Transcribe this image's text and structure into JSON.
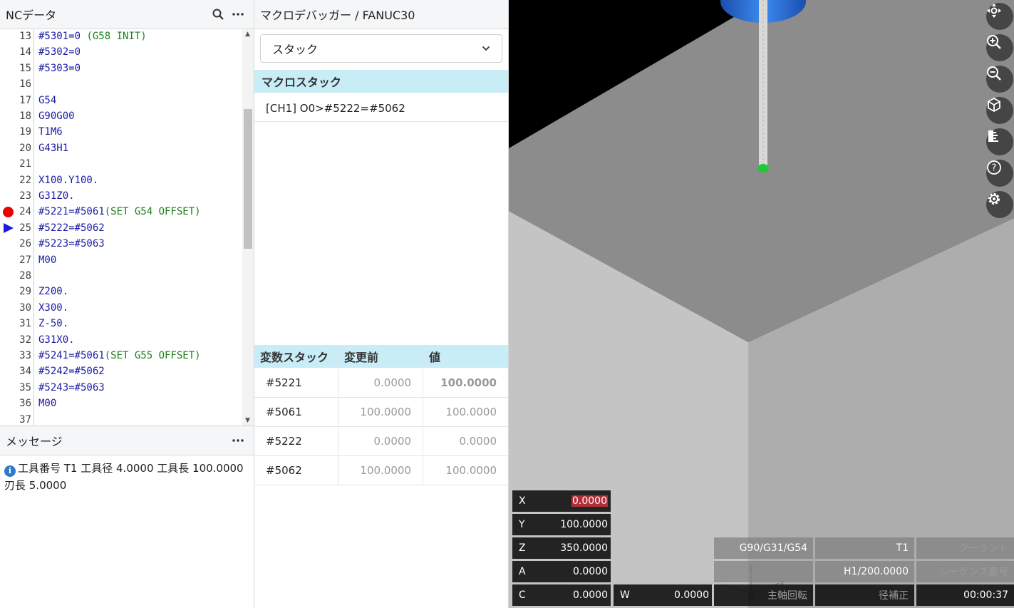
{
  "nc_panel": {
    "title": "NCデータ",
    "lines": [
      {
        "n": "13",
        "code": "#5301=0 ",
        "comment": "(G58 INIT)",
        "marker": ""
      },
      {
        "n": "14",
        "code": "#5302=0",
        "comment": "",
        "marker": ""
      },
      {
        "n": "15",
        "code": "#5303=0",
        "comment": "",
        "marker": ""
      },
      {
        "n": "16",
        "code": "",
        "comment": "",
        "marker": ""
      },
      {
        "n": "17",
        "code": "G54",
        "comment": "",
        "marker": ""
      },
      {
        "n": "18",
        "code": "G90G00",
        "comment": "",
        "marker": ""
      },
      {
        "n": "19",
        "code": "T1M6",
        "comment": "",
        "marker": ""
      },
      {
        "n": "20",
        "code": "G43H1",
        "comment": "",
        "marker": ""
      },
      {
        "n": "21",
        "code": "",
        "comment": "",
        "marker": ""
      },
      {
        "n": "22",
        "code": "X100.Y100.",
        "comment": "",
        "marker": ""
      },
      {
        "n": "23",
        "code": "G31Z0.",
        "comment": "",
        "marker": ""
      },
      {
        "n": "24",
        "code": "#5221=#5061",
        "comment": "(SET G54 OFFSET)",
        "marker": "breakpoint"
      },
      {
        "n": "25",
        "code": "#5222=#5062",
        "comment": "",
        "marker": "current"
      },
      {
        "n": "26",
        "code": "#5223=#5063",
        "comment": "",
        "marker": ""
      },
      {
        "n": "27",
        "code": "M00",
        "comment": "",
        "marker": ""
      },
      {
        "n": "28",
        "code": "",
        "comment": "",
        "marker": ""
      },
      {
        "n": "29",
        "code": "Z200.",
        "comment": "",
        "marker": ""
      },
      {
        "n": "30",
        "code": "X300.",
        "comment": "",
        "marker": ""
      },
      {
        "n": "31",
        "code": "Z-50.",
        "comment": "",
        "marker": ""
      },
      {
        "n": "32",
        "code": "G31X0.",
        "comment": "",
        "marker": ""
      },
      {
        "n": "33",
        "code": "#5241=#5061",
        "comment": "(SET G55 OFFSET)",
        "marker": ""
      },
      {
        "n": "34",
        "code": "#5242=#5062",
        "comment": "",
        "marker": ""
      },
      {
        "n": "35",
        "code": "#5243=#5063",
        "comment": "",
        "marker": ""
      },
      {
        "n": "36",
        "code": "M00",
        "comment": "",
        "marker": ""
      },
      {
        "n": "37",
        "code": "",
        "comment": "",
        "marker": ""
      }
    ]
  },
  "message_panel": {
    "title": "メッセージ",
    "info_icon_glyph": "i",
    "message": "工具番号 T1 工具径 4.0000 工具長 100.0000 刃長 5.0000"
  },
  "debugger": {
    "title": "マクロデバッガー / FANUC30",
    "select_value": "スタック",
    "macro_stack_header": "マクロスタック",
    "macro_stack_entries": [
      "[CH1] O0>#5222=#5062"
    ],
    "var_stack_headers": [
      "変数スタック",
      "変更前",
      "値"
    ],
    "var_rows": [
      {
        "name": "#5221",
        "prev": "0.0000",
        "value": "100.0000",
        "changed": true
      },
      {
        "name": "#5061",
        "prev": "100.0000",
        "value": "100.0000",
        "changed": false
      },
      {
        "name": "#5222",
        "prev": "0.0000",
        "value": "0.0000",
        "changed": false
      },
      {
        "name": "#5062",
        "prev": "100.0000",
        "value": "100.0000",
        "changed": false
      }
    ]
  },
  "view3d": {
    "colors": {
      "background": "#000000",
      "top_face": "#8c8c8c",
      "left_face": "#c4c4c4",
      "right_face": "#adadad",
      "spindle": "#2a6ad8",
      "tool_tip": "#22c83a"
    },
    "tool_buttons": [
      "pan-icon",
      "zoom-in-icon",
      "zoom-out-icon",
      "cube-view-icon",
      "ruler-icon",
      "help-icon",
      "settings-icon"
    ],
    "help_glyph": "?",
    "dro": [
      {
        "axis": "X",
        "value": "0.0000",
        "highlight": true
      },
      {
        "axis": "Y",
        "value": "100.0000",
        "highlight": false
      },
      {
        "axis": "Z",
        "value": "350.0000",
        "highlight": false
      },
      {
        "axis": "A",
        "value": "0.0000",
        "highlight": false
      },
      {
        "axis": "C",
        "value": "0.0000",
        "highlight": false
      }
    ],
    "dro_w": {
      "axis": "W",
      "value": "0.0000"
    },
    "status": {
      "modal": "G90/G31/G54",
      "tool": "T1",
      "coolant": "クーラント",
      "offset": "H1/200.0000",
      "sequence": "シーケンス番号",
      "spindle": "主軸回転",
      "radius_comp": "径補正",
      "time": "00:00:37"
    },
    "triad_labels": {
      "z": "Z",
      "x": "X",
      "m": "M"
    }
  }
}
